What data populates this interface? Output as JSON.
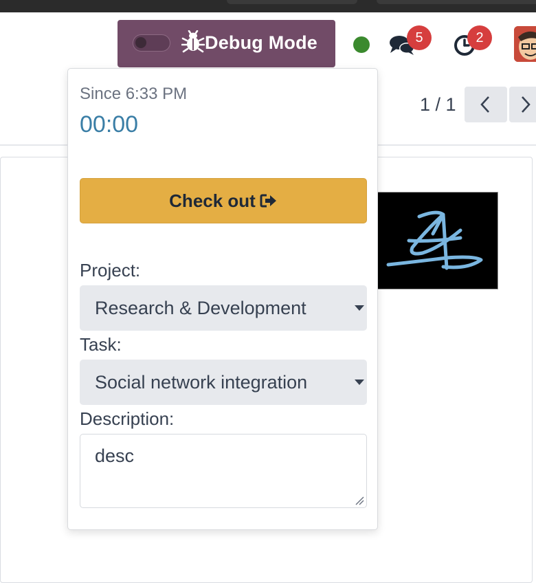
{
  "navbar": {
    "debug_label": "Debug Mode",
    "messages_count": "5",
    "activities_count": "2",
    "status_color": "#3b8a2e",
    "accent_color": "#714b67"
  },
  "pager": {
    "text": "1 / 1"
  },
  "attendance_popup": {
    "since_text": "Since 6:33 PM",
    "timer": "00:00",
    "checkout_label": "Check out",
    "project_label": "Project:",
    "project_value": "Research & Development",
    "task_label": "Task:",
    "task_value": "Social network integration",
    "description_label": "Description:",
    "description_value": "desc",
    "checkout_color": "#e4ae44"
  },
  "icons": {
    "debug": "bug-icon",
    "toggle": "toggle-switch",
    "messages": "chat-bubbles-icon",
    "activities": "clock-icon",
    "checkout": "sign-out-icon",
    "prev": "chevron-left-icon",
    "next": "chevron-right-icon"
  }
}
